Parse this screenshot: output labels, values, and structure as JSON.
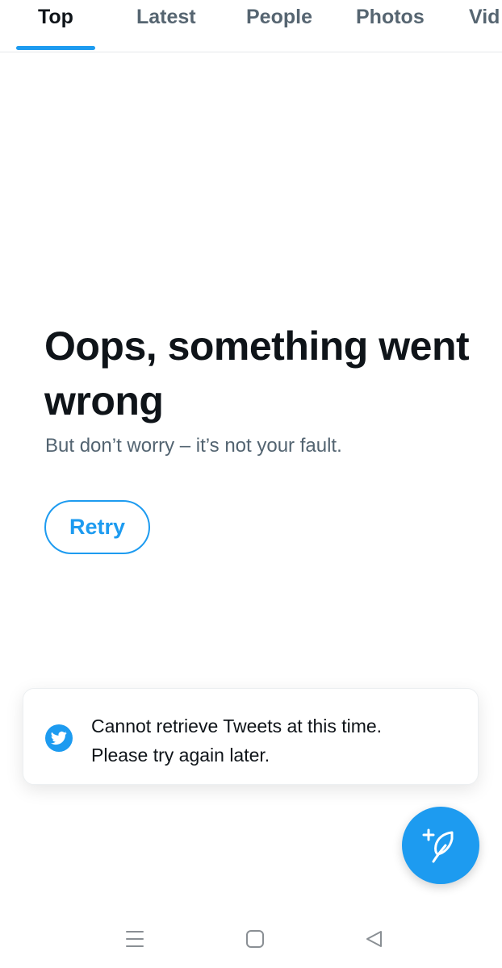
{
  "tabs": [
    {
      "label": "Top",
      "active": true
    },
    {
      "label": "Latest",
      "active": false
    },
    {
      "label": "People",
      "active": false
    },
    {
      "label": "Photos",
      "active": false
    },
    {
      "label": "Vid",
      "active": false
    }
  ],
  "error": {
    "title": "Oops, something went wrong",
    "subtitle": "But don’t worry – it’s not your fault.",
    "retry_label": "Retry"
  },
  "toast": {
    "icon": "twitter-bird-icon",
    "line1": "Cannot retrieve Tweets at this time.",
    "line2": "Please try again later."
  },
  "fab": {
    "icon": "compose-tweet-icon"
  },
  "system_nav": {
    "icons": [
      "menu-icon",
      "home-square-icon",
      "back-triangle-icon"
    ]
  },
  "colors": {
    "accent": "#1d9bf0",
    "text_primary": "#0f1419",
    "text_secondary": "#536471",
    "tab_inactive": "#566571",
    "divider": "#e6e9ec"
  }
}
